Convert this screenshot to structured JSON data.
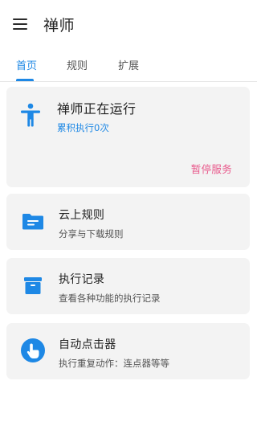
{
  "app": {
    "title": "禅师"
  },
  "tabs": [
    {
      "label": "首页",
      "active": true
    },
    {
      "label": "规则",
      "active": false
    },
    {
      "label": "扩展",
      "active": false
    }
  ],
  "status": {
    "title": "禅师正在运行",
    "subtitle": "累积执行0次",
    "action_label": "暂停服务"
  },
  "cards": [
    {
      "title": "云上规则",
      "subtitle": "分享与下载规则",
      "icon": "folder-icon"
    },
    {
      "title": "执行记录",
      "subtitle": "查看各种功能的执行记录",
      "icon": "archive-icon"
    },
    {
      "title": "自动点击器",
      "subtitle": "执行重复动作：连点器等等",
      "icon": "touch-icon"
    }
  ],
  "colors": {
    "accent": "#1e88e5",
    "pause": "#e8578a",
    "card_bg": "#f3f3f3"
  }
}
